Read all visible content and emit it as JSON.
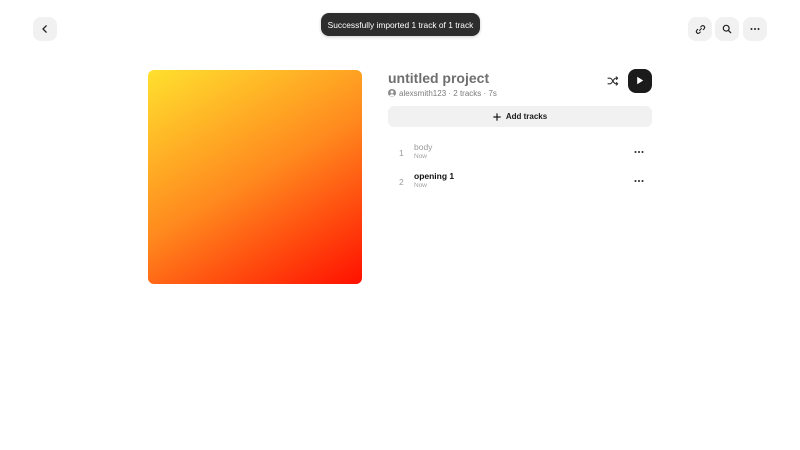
{
  "toast": {
    "message": "Successfully imported 1 track of 1 track"
  },
  "header": {
    "back_icon": "chevron-left-icon",
    "link_icon": "link-icon",
    "search_icon": "search-icon",
    "more_icon": "more-horizontal-icon"
  },
  "cover": {
    "gradient_start": "#FFE02E",
    "gradient_mid": "#FF8A1E",
    "gradient_end": "#FF1000"
  },
  "project": {
    "title": "untitled project",
    "owner": "alexsmith123",
    "track_count": "2 tracks",
    "duration": "7s",
    "separator": "·"
  },
  "actions": {
    "shuffle_icon": "shuffle-icon",
    "play_icon": "play-icon",
    "add_tracks_label": "Add tracks"
  },
  "tracks": [
    {
      "number": "1",
      "name": "body",
      "time": "Now"
    },
    {
      "number": "2",
      "name": "opening 1",
      "time": "Now"
    }
  ],
  "colors": {
    "toast_bg": "#2D2D2D",
    "button_bg": "#F1F1F1",
    "play_bg": "#1B1B1B"
  }
}
